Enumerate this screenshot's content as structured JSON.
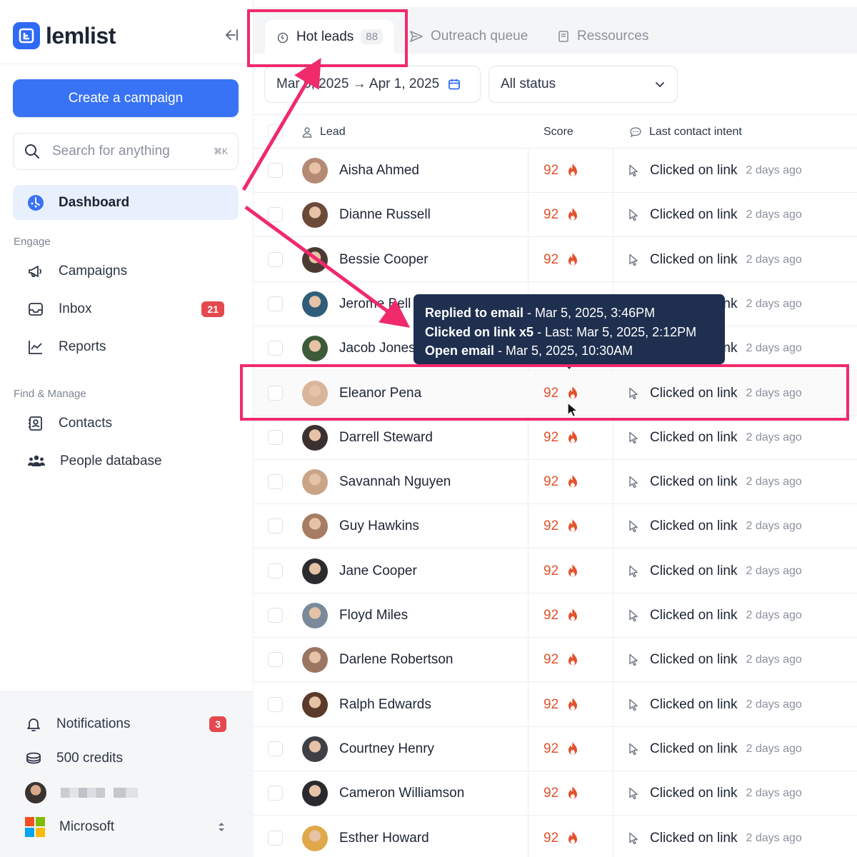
{
  "app": {
    "name": "lemlist"
  },
  "sidebar": {
    "create_label": "Create a campaign",
    "search_placeholder": "Search for anything",
    "search_shortcut": "⌘K",
    "active_item": {
      "label": "Dashboard",
      "icon": "dashboard-icon"
    },
    "sections": [
      {
        "label": "Engage",
        "items": [
          {
            "label": "Campaigns",
            "icon": "megaphone-icon"
          },
          {
            "label": "Inbox",
            "icon": "inbox-icon",
            "badge": "21"
          },
          {
            "label": "Reports",
            "icon": "chart-icon"
          }
        ]
      },
      {
        "label": "Find & Manage",
        "items": [
          {
            "label": "Contacts",
            "icon": "contact-card-icon"
          },
          {
            "label": "People database",
            "icon": "people-icon"
          }
        ]
      }
    ],
    "bottom": {
      "notifications_label": "Notifications",
      "notifications_badge": "3",
      "credits_label": "500 credits",
      "workspace_label": "Microsoft"
    }
  },
  "tabs": [
    {
      "label": "Hot leads",
      "count": "88",
      "active": true
    },
    {
      "label": "Outreach queue"
    },
    {
      "label": "Ressources"
    }
  ],
  "filters": {
    "date_range": "Mar 6, 2025 → Apr 1, 2025",
    "status": "All status"
  },
  "table": {
    "headers": {
      "lead": "Lead",
      "score": "Score",
      "intent": "Last contact intent"
    },
    "rows": [
      {
        "name": "Aisha Ahmed",
        "score": "92",
        "intent": "Clicked on link",
        "ago": "2 days ago",
        "avatar": "#b48a74"
      },
      {
        "name": "Dianne Russell",
        "score": "92",
        "intent": "Clicked on link",
        "ago": "2 days ago",
        "avatar": "#6b4a3a"
      },
      {
        "name": "Bessie Cooper",
        "score": "92",
        "intent": "Clicked on link",
        "ago": "2 days ago",
        "avatar": "#4a3a34"
      },
      {
        "name": "Jerome Bell",
        "score": "92",
        "intent": "Clicked on link",
        "ago": "2 days ago",
        "avatar": "#2f5d7a"
      },
      {
        "name": "Jacob Jones",
        "score": "92",
        "intent": "Clicked on link",
        "ago": "2 days ago",
        "avatar": "#3d5a3a"
      },
      {
        "name": "Eleanor Pena",
        "score": "92",
        "intent": "Clicked on link",
        "ago": "2 days ago",
        "avatar": "#d9b59a"
      },
      {
        "name": "Darrell Steward",
        "score": "92",
        "intent": "Clicked on link",
        "ago": "2 days ago",
        "avatar": "#3a3030"
      },
      {
        "name": "Savannah Nguyen",
        "score": "92",
        "intent": "Clicked on link",
        "ago": "2 days ago",
        "avatar": "#c9a487"
      },
      {
        "name": "Guy Hawkins",
        "score": "92",
        "intent": "Clicked on link",
        "ago": "2 days ago",
        "avatar": "#a67c62"
      },
      {
        "name": "Jane Cooper",
        "score": "92",
        "intent": "Clicked on link",
        "ago": "2 days ago",
        "avatar": "#2b2b30"
      },
      {
        "name": "Floyd Miles",
        "score": "92",
        "intent": "Clicked on link",
        "ago": "2 days ago",
        "avatar": "#7a8a9a"
      },
      {
        "name": "Darlene Robertson",
        "score": "92",
        "intent": "Clicked on link",
        "ago": "2 days ago",
        "avatar": "#9a7562"
      },
      {
        "name": "Ralph Edwards",
        "score": "92",
        "intent": "Clicked on link",
        "ago": "2 days ago",
        "avatar": "#5a3a2a"
      },
      {
        "name": "Courtney Henry",
        "score": "92",
        "intent": "Clicked on link",
        "ago": "2 days ago",
        "avatar": "#3f3f45"
      },
      {
        "name": "Cameron Williamson",
        "score": "92",
        "intent": "Clicked on link",
        "ago": "2 days ago",
        "avatar": "#2a2a2e"
      },
      {
        "name": "Esther Howard",
        "score": "92",
        "intent": "Clicked on link",
        "ago": "2 days ago",
        "avatar": "#e0a84a"
      }
    ]
  },
  "tooltip": {
    "lines": [
      {
        "bold": "Replied to email",
        "rest": " - Mar 5, 2025, 3:46PM"
      },
      {
        "bold": "Clicked on link x5",
        "rest": " - Last: Mar 5, 2025, 2:12PM"
      },
      {
        "bold": "Open email",
        "rest": " - Mar 5, 2025, 10:30AM"
      }
    ]
  },
  "colors": {
    "accent": "#3873f5",
    "score": "#e2512b",
    "highlight": "#f02a6b",
    "tooltip_bg": "#1f2f4f"
  }
}
